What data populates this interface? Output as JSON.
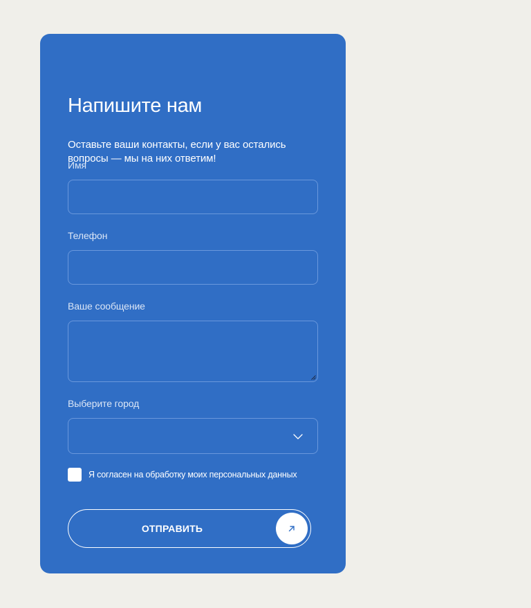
{
  "form": {
    "title": "Напишите нам",
    "subtitle": "Оставьте ваши контакты, если у вас остались вопросы — мы на них ответим!",
    "fields": {
      "name": {
        "label": "Имя",
        "value": ""
      },
      "phone": {
        "label": "Телефон",
        "value": ""
      },
      "message": {
        "label": "Ваше сообщение",
        "value": ""
      },
      "city": {
        "label": "Выберите город",
        "value": ""
      }
    },
    "consent_label": "Я согласен на обработку моих персональных данных",
    "consent_checked": false,
    "submit_label": "ОТПРАВИТЬ"
  },
  "icons": {
    "select": "chevron-down-icon",
    "submit": "arrow-up-right-icon"
  },
  "colors": {
    "page_background": "#f0efea",
    "card_background": "#306ec5",
    "field_border": "#6a98dc",
    "text": "#ffffff",
    "arrow_icon": "#306ec5"
  }
}
